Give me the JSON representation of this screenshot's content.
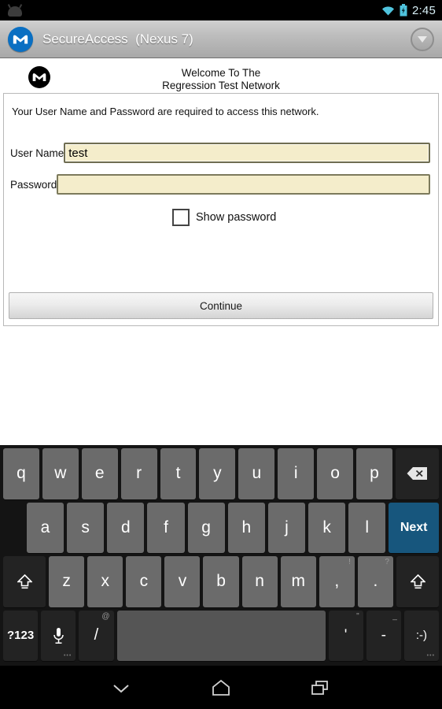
{
  "statusbar": {
    "notification_icon": "android-head-icon",
    "wifi_icon": "wifi-icon",
    "battery_icon": "battery-charging-icon",
    "clock": "2:45"
  },
  "appbar": {
    "logo_icon": "motorola-logo-icon",
    "title": "SecureAccess  (Nexus 7)",
    "dropdown_icon": "chevron-down-circle-icon"
  },
  "page": {
    "logo_icon": "motorola-logo-black-icon",
    "welcome_line1": "Welcome To The",
    "welcome_line2": "Regression Test Network",
    "intro": "Your User Name and Password are required to access this network.",
    "fields": [
      {
        "label": "User Name",
        "value": "test",
        "placeholder": ""
      },
      {
        "label": "Password",
        "value": "",
        "placeholder": ""
      }
    ],
    "show_password_label": "Show password",
    "show_password_checked": false,
    "continue_label": "Continue"
  },
  "keyboard": {
    "rows": [
      [
        {
          "label": "q"
        },
        {
          "label": "w"
        },
        {
          "label": "e"
        },
        {
          "label": "r"
        },
        {
          "label": "t"
        },
        {
          "label": "y"
        },
        {
          "label": "u"
        },
        {
          "label": "i"
        },
        {
          "label": "o"
        },
        {
          "label": "p"
        },
        {
          "label": "",
          "icon": "backspace-icon"
        }
      ],
      [
        {
          "label": "a"
        },
        {
          "label": "s"
        },
        {
          "label": "d"
        },
        {
          "label": "f"
        },
        {
          "label": "g"
        },
        {
          "label": "h"
        },
        {
          "label": "j"
        },
        {
          "label": "k"
        },
        {
          "label": "l"
        },
        {
          "label": "Next"
        }
      ],
      [
        {
          "label": "",
          "icon": "shift-icon"
        },
        {
          "label": "z"
        },
        {
          "label": "x"
        },
        {
          "label": "c"
        },
        {
          "label": "v"
        },
        {
          "label": "b"
        },
        {
          "label": "n"
        },
        {
          "label": "m"
        },
        {
          "label": ",",
          "hint": "!"
        },
        {
          "label": ".",
          "hint": "?"
        },
        {
          "label": "",
          "icon": "shift-icon"
        }
      ],
      [
        {
          "label": "?123"
        },
        {
          "label": "",
          "icon": "microphone-icon"
        },
        {
          "label": "/",
          "hint": "@"
        },
        {
          "label": "",
          "icon": "spacebar"
        },
        {
          "label": "'",
          "hint": "\""
        },
        {
          "label": "-",
          "hint": "_"
        },
        {
          "label": ":-)"
        }
      ]
    ]
  },
  "navbar": {
    "back_icon": "hide-keyboard-chevron-icon",
    "home_icon": "home-icon",
    "recents_icon": "recent-apps-icon"
  },
  "colors": {
    "accent_blue": "#0a6fc2",
    "next_key": "#17567d",
    "field_bg": "#f4edcb",
    "field_border": "#7c7a5c",
    "key_bg": "#6b6b6b",
    "keyboard_bg": "#141414"
  }
}
